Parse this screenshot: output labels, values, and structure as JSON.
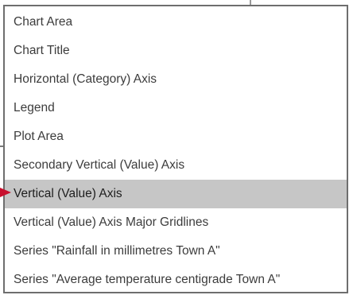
{
  "dropdown": {
    "items": [
      {
        "label": "Chart Area"
      },
      {
        "label": "Chart Title"
      },
      {
        "label": "Horizontal (Category) Axis"
      },
      {
        "label": "Legend"
      },
      {
        "label": "Plot Area"
      },
      {
        "label": "Secondary Vertical (Value) Axis"
      },
      {
        "label": "Vertical (Value) Axis"
      },
      {
        "label": "Vertical (Value) Axis Major Gridlines"
      },
      {
        "label": "Series \"Rainfall in millimetres Town A\""
      },
      {
        "label": "Series \"Average temperature centigrade Town A\""
      }
    ],
    "selected_label": "Vertical (Value) Axis"
  },
  "colors": {
    "border": "#6e6e6e",
    "text": "#3c3c3c",
    "selected_background": "#c6c6c6",
    "pointer_arrow": "#c8102e"
  },
  "icons": {
    "pointer": "arrow-right-icon"
  }
}
